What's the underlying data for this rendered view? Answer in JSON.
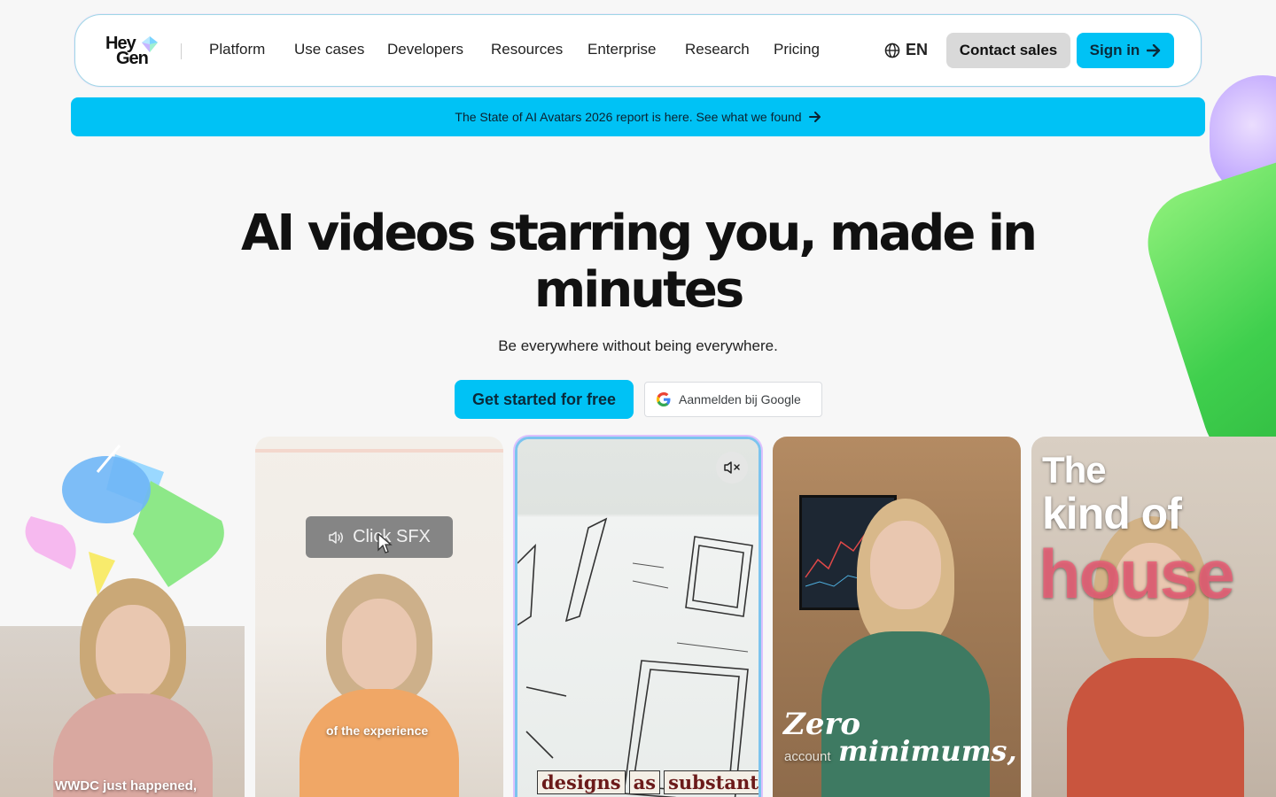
{
  "brand": {
    "logo_top": "Hey",
    "logo_bottom": "Gen",
    "accent": "#00c2f5"
  },
  "nav": {
    "items": [
      "Platform",
      "Use cases",
      "Developers",
      "Resources",
      "Enterprise",
      "Research",
      "Pricing"
    ],
    "language": "EN",
    "language_icon": "globe-icon",
    "contact_label": "Contact sales",
    "signin_label": "Sign in",
    "signin_icon": "arrow-right-icon"
  },
  "banner": {
    "text": "The State of AI Avatars 2026 report is here. See what we found",
    "icon": "arrow-right-icon"
  },
  "hero": {
    "title": "AI videos starring you, made in minutes",
    "subtitle": "Be everywhere without being everywhere.",
    "cta_label": "Get started for free",
    "google_label": "Aanmelden bij Google"
  },
  "videos": [
    {
      "caption": "WWDC just happened,"
    },
    {
      "chip_label": "Click SFX",
      "chip_icon": "speaker-icon",
      "caption": "of the experience"
    },
    {
      "mute_icon": "muted-speaker-icon",
      "words": [
        "designs",
        "as",
        "substantially"
      ]
    },
    {
      "caption_big": "Zero",
      "caption_small": "account",
      "caption_italic": "minimums,"
    },
    {
      "caption_line1": "The",
      "caption_line2": "kind of",
      "caption_line3": "house"
    }
  ]
}
